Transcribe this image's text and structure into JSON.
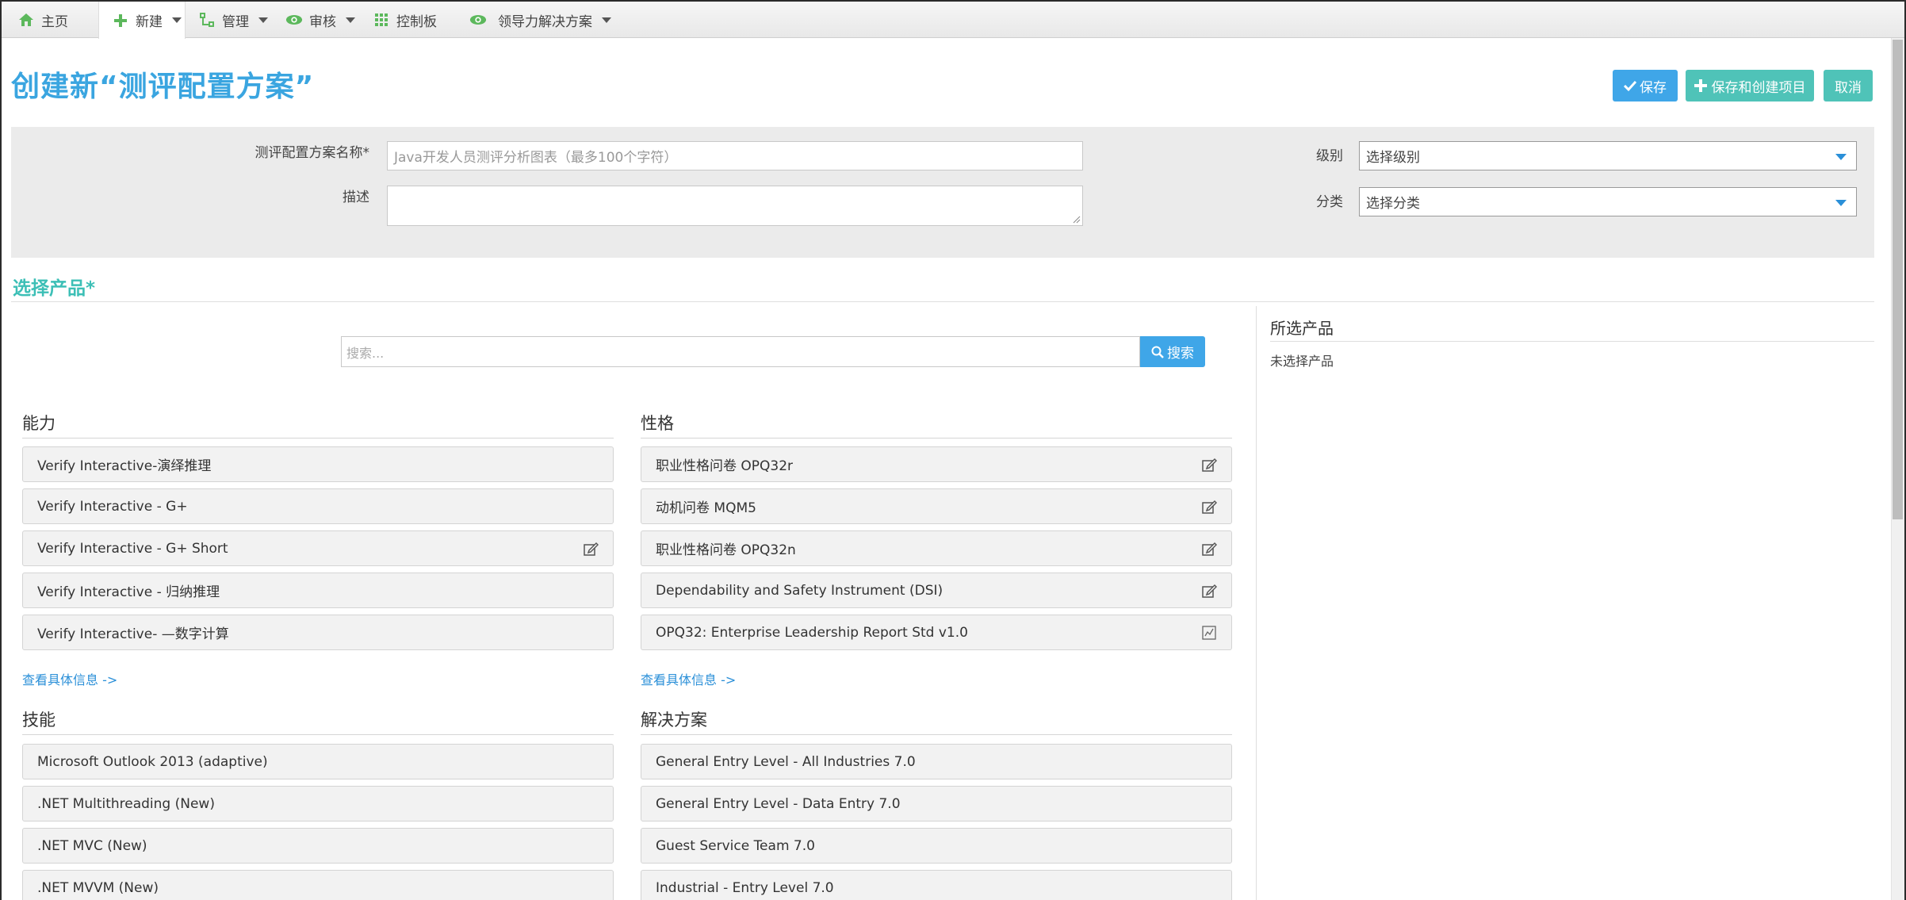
{
  "nav": {
    "items": [
      {
        "label": "主页",
        "icon": "home-icon",
        "dropdown": false
      },
      {
        "label": "新建",
        "icon": "plus-icon",
        "dropdown": true,
        "active": true
      },
      {
        "label": "管理",
        "icon": "manage-icon",
        "dropdown": true
      },
      {
        "label": "审核",
        "icon": "eye-icon",
        "dropdown": true
      },
      {
        "label": "控制板",
        "icon": "grid-icon",
        "dropdown": false
      },
      {
        "label": "领导力解决方案",
        "icon": "eye-icon",
        "dropdown": true
      }
    ]
  },
  "page": {
    "title": "创建新“测评配置方案”",
    "buttons": {
      "save": "保存",
      "save_create": "保存和创建项目",
      "cancel": "取消"
    }
  },
  "form": {
    "name_label": "测评配置方案名称*",
    "name_placeholder": "Java开发人员测评分析图表（最多100个字符）",
    "desc_label": "描述",
    "level_label": "级别",
    "level_value": "选择级别",
    "category_label": "分类",
    "category_value": "选择分类"
  },
  "products": {
    "section_title": "选择产品*",
    "search_placeholder": "搜索...",
    "search_button": "搜索",
    "ability": {
      "title": "能力",
      "items": [
        {
          "label": "Verify Interactive-演绎推理",
          "icon": ""
        },
        {
          "label": "Verify Interactive - G+",
          "icon": ""
        },
        {
          "label": "Verify Interactive - G+ Short",
          "icon": "edit-icon"
        },
        {
          "label": "Verify Interactive - 归纳推理",
          "icon": ""
        },
        {
          "label": "Verify Interactive- —数字计算",
          "icon": ""
        }
      ],
      "more": "查看具体信息 ->"
    },
    "personality": {
      "title": "性格",
      "items": [
        {
          "label": "职业性格问卷 OPQ32r",
          "icon": "edit-icon"
        },
        {
          "label": "动机问卷 MQM5",
          "icon": "edit-icon"
        },
        {
          "label": "职业性格问卷 OPQ32n",
          "icon": "edit-icon"
        },
        {
          "label": "Dependability and Safety Instrument (DSI)",
          "icon": "edit-icon"
        },
        {
          "label": "OPQ32: Enterprise Leadership Report Std v1.0",
          "icon": "report-icon"
        }
      ],
      "more": "查看具体信息 ->"
    },
    "skills": {
      "title": "技能",
      "items": [
        "Microsoft Outlook 2013 (adaptive)",
        ".NET Multithreading (New)",
        ".NET MVC (New)",
        ".NET MVVM (New)"
      ]
    },
    "solutions": {
      "title": "解决方案",
      "items": [
        "General Entry Level - All Industries 7.0",
        "General Entry Level - Data Entry 7.0",
        "Guest Service Team 7.0",
        "Industrial - Entry Level 7.0"
      ]
    },
    "selected": {
      "title": "所选产品",
      "empty": "未选择产品"
    }
  },
  "colors": {
    "accent_blue": "#3aa5e0",
    "accent_teal": "#3cbfb6",
    "nav_icon_green": "#5cb85c"
  }
}
